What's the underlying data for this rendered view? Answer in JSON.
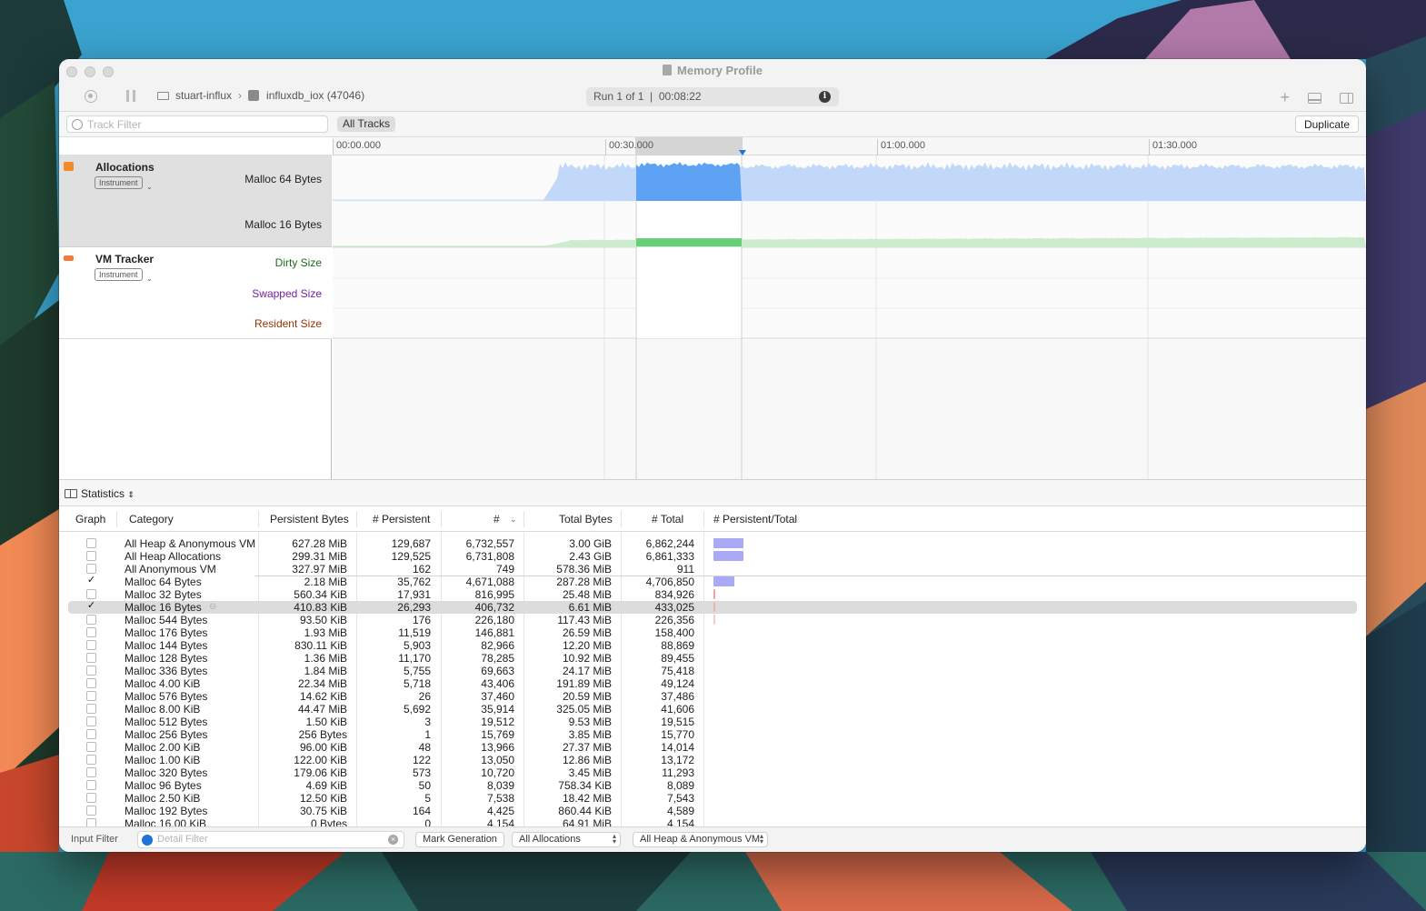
{
  "window": {
    "title": "Memory Profile",
    "target_machine": "stuart-influx",
    "target_process": "influxdb_iox (47046)",
    "run_info": "Run 1 of 1  |  00:08:22"
  },
  "filterbar": {
    "track_filter_placeholder": "Track Filter",
    "all_tracks_label": "All Tracks",
    "duplicate_label": "Duplicate"
  },
  "timeline": {
    "ticks": [
      "00:00.000",
      "00:30.000",
      "01:00.000",
      "01:30.000"
    ],
    "instruments": [
      {
        "name": "Allocations",
        "tag": "Instrument",
        "color": "#f08a2a",
        "lanes": [
          {
            "label": "Malloc 64 Bytes",
            "color": "#222222"
          },
          {
            "label": "Malloc 16 Bytes",
            "color": "#222222"
          }
        ]
      },
      {
        "name": "VM Tracker",
        "tag": "Instrument",
        "color": "#f5793a",
        "lanes": [
          {
            "label": "Dirty Size",
            "color": "#1a6b1a"
          },
          {
            "label": "Swapped Size",
            "color": "#7a1fa2"
          },
          {
            "label": "Resident Size",
            "color": "#9a3200"
          }
        ]
      }
    ]
  },
  "statistics": {
    "view_label": "Statistics",
    "columns": [
      "Graph",
      "Category",
      "Persistent Bytes",
      "# Persistent",
      "#",
      "Total Bytes",
      "# Total",
      "# Persistent/Total"
    ],
    "rows": [
      {
        "checked": false,
        "category": "All Heap & Anonymous VM",
        "persistent_bytes": "627.28 MiB",
        "n_persistent": "129,687",
        "n": "6,732,557",
        "total_bytes": "3.00 GiB",
        "n_total": "6,862,244",
        "bar_fraction": 1.0,
        "bar_color": "#a9a9f5",
        "selected": false
      },
      {
        "checked": false,
        "category": "All Heap Allocations",
        "persistent_bytes": "299.31 MiB",
        "n_persistent": "129,525",
        "n": "6,731,808",
        "total_bytes": "2.43 GiB",
        "n_total": "6,861,333",
        "bar_fraction": 1.0,
        "bar_color": "#a9a9f5",
        "selected": false
      },
      {
        "checked": false,
        "category": "All Anonymous VM",
        "persistent_bytes": "327.97 MiB",
        "n_persistent": "162",
        "n": "749",
        "total_bytes": "578.36 MiB",
        "n_total": "911",
        "bar_fraction": 0,
        "bar_color": "#a9a9f5",
        "selected": false
      },
      {
        "checked": true,
        "category": "Malloc 64 Bytes",
        "persistent_bytes": "2.18 MiB",
        "n_persistent": "35,762",
        "n": "4,671,088",
        "total_bytes": "287.28 MiB",
        "n_total": "4,706,850",
        "bar_fraction": 0.7,
        "bar_color": "#a9a9f5",
        "selected": false
      },
      {
        "checked": false,
        "category": "Malloc 32 Bytes",
        "persistent_bytes": "560.34 KiB",
        "n_persistent": "17,931",
        "n": "816,995",
        "total_bytes": "25.48 MiB",
        "n_total": "834,926",
        "bar_fraction": 0.12,
        "bar_color": "#f4a0a0",
        "selected": false
      },
      {
        "checked": true,
        "category": "Malloc 16 Bytes",
        "persistent_bytes": "410.83 KiB",
        "n_persistent": "26,293",
        "n": "406,732",
        "total_bytes": "6.61 MiB",
        "n_total": "433,025",
        "bar_fraction": 0.06,
        "bar_color": "#f4a0a0",
        "selected": true
      },
      {
        "checked": false,
        "category": "Malloc 544 Bytes",
        "persistent_bytes": "93.50 KiB",
        "n_persistent": "176",
        "n": "226,180",
        "total_bytes": "117.43 MiB",
        "n_total": "226,356",
        "bar_fraction": 0.03,
        "bar_color": "#f4a0a0",
        "selected": false
      },
      {
        "checked": false,
        "category": "Malloc 176 Bytes",
        "persistent_bytes": "1.93 MiB",
        "n_persistent": "11,519",
        "n": "146,881",
        "total_bytes": "26.59 MiB",
        "n_total": "158,400",
        "bar_fraction": 0,
        "bar_color": "#f4a0a0",
        "selected": false
      },
      {
        "checked": false,
        "category": "Malloc 144 Bytes",
        "persistent_bytes": "830.11 KiB",
        "n_persistent": "5,903",
        "n": "82,966",
        "total_bytes": "12.20 MiB",
        "n_total": "88,869",
        "bar_fraction": 0,
        "bar_color": "#f4a0a0",
        "selected": false
      },
      {
        "checked": false,
        "category": "Malloc 128 Bytes",
        "persistent_bytes": "1.36 MiB",
        "n_persistent": "11,170",
        "n": "78,285",
        "total_bytes": "10.92 MiB",
        "n_total": "89,455",
        "bar_fraction": 0,
        "bar_color": "#f4a0a0",
        "selected": false
      },
      {
        "checked": false,
        "category": "Malloc 336 Bytes",
        "persistent_bytes": "1.84 MiB",
        "n_persistent": "5,755",
        "n": "69,663",
        "total_bytes": "24.17 MiB",
        "n_total": "75,418",
        "bar_fraction": 0,
        "bar_color": "#f4a0a0",
        "selected": false
      },
      {
        "checked": false,
        "category": "Malloc 4.00 KiB",
        "persistent_bytes": "22.34 MiB",
        "n_persistent": "5,718",
        "n": "43,406",
        "total_bytes": "191.89 MiB",
        "n_total": "49,124",
        "bar_fraction": 0,
        "bar_color": "#f4a0a0",
        "selected": false
      },
      {
        "checked": false,
        "category": "Malloc 576 Bytes",
        "persistent_bytes": "14.62 KiB",
        "n_persistent": "26",
        "n": "37,460",
        "total_bytes": "20.59 MiB",
        "n_total": "37,486",
        "bar_fraction": 0,
        "bar_color": "#f4a0a0",
        "selected": false
      },
      {
        "checked": false,
        "category": "Malloc 8.00 KiB",
        "persistent_bytes": "44.47 MiB",
        "n_persistent": "5,692",
        "n": "35,914",
        "total_bytes": "325.05 MiB",
        "n_total": "41,606",
        "bar_fraction": 0,
        "bar_color": "#f4a0a0",
        "selected": false
      },
      {
        "checked": false,
        "category": "Malloc 512 Bytes",
        "persistent_bytes": "1.50 KiB",
        "n_persistent": "3",
        "n": "19,512",
        "total_bytes": "9.53 MiB",
        "n_total": "19,515",
        "bar_fraction": 0,
        "bar_color": "#f4a0a0",
        "selected": false
      },
      {
        "checked": false,
        "category": "Malloc 256 Bytes",
        "persistent_bytes": "256 Bytes",
        "n_persistent": "1",
        "n": "15,769",
        "total_bytes": "3.85 MiB",
        "n_total": "15,770",
        "bar_fraction": 0,
        "bar_color": "#f4a0a0",
        "selected": false
      },
      {
        "checked": false,
        "category": "Malloc 2.00 KiB",
        "persistent_bytes": "96.00 KiB",
        "n_persistent": "48",
        "n": "13,966",
        "total_bytes": "27.37 MiB",
        "n_total": "14,014",
        "bar_fraction": 0,
        "bar_color": "#f4a0a0",
        "selected": false
      },
      {
        "checked": false,
        "category": "Malloc 1.00 KiB",
        "persistent_bytes": "122.00 KiB",
        "n_persistent": "122",
        "n": "13,050",
        "total_bytes": "12.86 MiB",
        "n_total": "13,172",
        "bar_fraction": 0,
        "bar_color": "#f4a0a0",
        "selected": false
      },
      {
        "checked": false,
        "category": "Malloc 320 Bytes",
        "persistent_bytes": "179.06 KiB",
        "n_persistent": "573",
        "n": "10,720",
        "total_bytes": "3.45 MiB",
        "n_total": "11,293",
        "bar_fraction": 0,
        "bar_color": "#f4a0a0",
        "selected": false
      },
      {
        "checked": false,
        "category": "Malloc 96 Bytes",
        "persistent_bytes": "4.69 KiB",
        "n_persistent": "50",
        "n": "8,039",
        "total_bytes": "758.34 KiB",
        "n_total": "8,089",
        "bar_fraction": 0,
        "bar_color": "#f4a0a0",
        "selected": false
      },
      {
        "checked": false,
        "category": "Malloc 2.50 KiB",
        "persistent_bytes": "12.50 KiB",
        "n_persistent": "5",
        "n": "7,538",
        "total_bytes": "18.42 MiB",
        "n_total": "7,543",
        "bar_fraction": 0,
        "bar_color": "#f4a0a0",
        "selected": false
      },
      {
        "checked": false,
        "category": "Malloc 192 Bytes",
        "persistent_bytes": "30.75 KiB",
        "n_persistent": "164",
        "n": "4,425",
        "total_bytes": "860.44 KiB",
        "n_total": "4,589",
        "bar_fraction": 0,
        "bar_color": "#f4a0a0",
        "selected": false
      },
      {
        "checked": false,
        "category": "Malloc 16.00 KiB",
        "persistent_bytes": "0 Bytes",
        "n_persistent": "0",
        "n": "4,154",
        "total_bytes": "64.91 MiB",
        "n_total": "4,154",
        "bar_fraction": 0,
        "bar_color": "#f4a0a0",
        "selected": false
      }
    ]
  },
  "bottom_bar": {
    "input_filter_label": "Input Filter",
    "detail_filter_placeholder": "Detail Filter",
    "mark_generation_label": "Mark Generation",
    "allocation_type": "All Allocations",
    "allocation_scope": "All Heap & Anonymous VM"
  },
  "colors": {
    "malloc64_fill": "#c2d8f8",
    "malloc64_selected": "#5ea2f4",
    "malloc16_fill": "#cdeccd",
    "malloc16_selected": "#69d07a",
    "accent": "#1f72d6"
  }
}
